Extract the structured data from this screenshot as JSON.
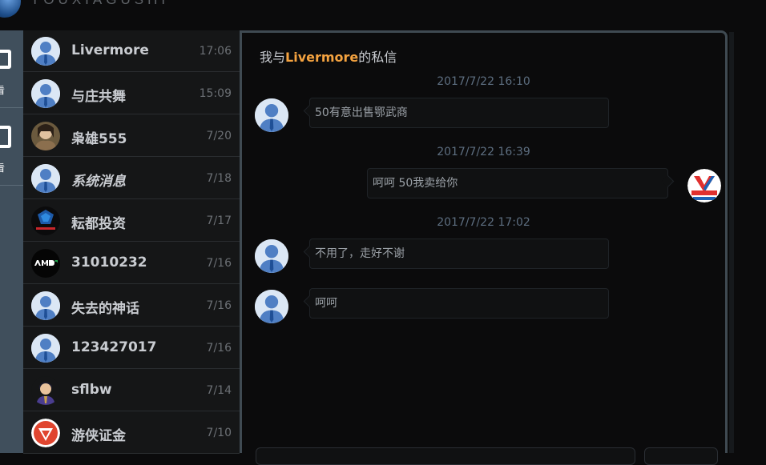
{
  "brand": {
    "text": "YOUXIAGUSHI"
  },
  "rail": {
    "items": [
      {
        "icon": "checkbox-icon",
        "label": "看"
      },
      {
        "icon": "edit-icon",
        "label": "看"
      }
    ]
  },
  "conversations": [
    {
      "name": "Livermore",
      "time": "17:06",
      "avatar": "default",
      "italic": false
    },
    {
      "name": "与庄共舞",
      "time": "15:09",
      "avatar": "default",
      "italic": false
    },
    {
      "name": "枭雄555",
      "time": "7/20",
      "avatar": "photo-warrior",
      "italic": false
    },
    {
      "name": "系统消息",
      "time": "7/18",
      "avatar": "default",
      "italic": true
    },
    {
      "name": "耘都投资",
      "time": "7/17",
      "avatar": "logo-red-blue",
      "italic": false
    },
    {
      "name": "31010232",
      "time": "7/16",
      "avatar": "logo-amd",
      "italic": false
    },
    {
      "name": "失去的神话",
      "time": "7/16",
      "avatar": "default",
      "italic": false
    },
    {
      "name": "123427017",
      "time": "7/16",
      "avatar": "default",
      "italic": false
    },
    {
      "name": "sflbw",
      "time": "7/14",
      "avatar": "photo-anime-man",
      "italic": false
    },
    {
      "name": "游侠证金",
      "time": "7/10",
      "avatar": "logo-red-ring",
      "italic": false
    }
  ],
  "chat": {
    "title_prefix": "我与",
    "title_user": "Livermore",
    "title_suffix": "的私信",
    "messages": [
      {
        "timestamp": "2017/7/22 16:10",
        "side": "left",
        "text": "50有意出售鄂武商"
      },
      {
        "timestamp": "2017/7/22 16:39",
        "side": "right",
        "text": "呵呵 50我卖给你"
      },
      {
        "timestamp": "2017/7/22 17:02",
        "side": "left",
        "text": "不用了，走好不谢"
      },
      {
        "timestamp": "",
        "side": "left",
        "text": "呵呵"
      }
    ],
    "input_placeholder": "",
    "send_label": ""
  },
  "colors": {
    "accent": "#f5a340",
    "rail": "#404f5c",
    "panel_border": "#3f4a52",
    "timestamp": "#5d6e80"
  }
}
